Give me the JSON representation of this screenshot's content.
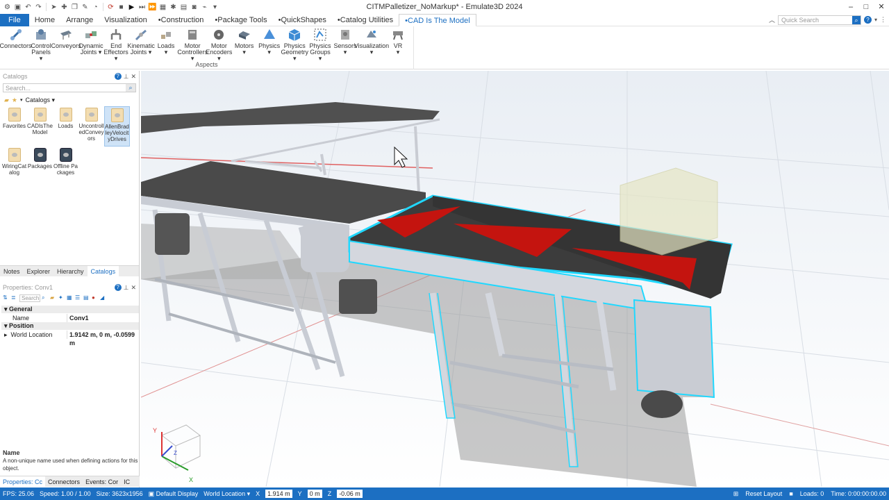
{
  "window": {
    "title": "CITMPalletizer_NoMarkup* - Emulate3D 2024",
    "controls": [
      "–",
      "□",
      "✕"
    ]
  },
  "tabs": [
    {
      "label": "File"
    },
    {
      "label": "Home"
    },
    {
      "label": "Arrange"
    },
    {
      "label": "Visualization"
    },
    {
      "label": "•Construction"
    },
    {
      "label": "•Package Tools"
    },
    {
      "label": "•QuickShapes"
    },
    {
      "label": "•Catalog Utilities"
    },
    {
      "label": "•CAD Is The Model"
    }
  ],
  "quick_search": {
    "placeholder": "Quick Search"
  },
  "ribbon": {
    "group_label": "Aspects",
    "buttons": [
      {
        "label": "Connectors"
      },
      {
        "label": "Control\nPanels ▾"
      },
      {
        "label": "Conveyors"
      },
      {
        "label": "Dynamic\nJoints ▾"
      },
      {
        "label": "End\nEffectors ▾"
      },
      {
        "label": "Kinematic\nJoints ▾"
      },
      {
        "label": "Loads\n▾"
      },
      {
        "label": "Motor\nControllers ▾"
      },
      {
        "label": "Motor\nEncoders ▾"
      },
      {
        "label": "Motors\n▾"
      },
      {
        "label": "Physics\n▾"
      },
      {
        "label": "Physics\nGeometry ▾"
      },
      {
        "label": "Physics\nGroups ▾"
      },
      {
        "label": "Sensors\n▾"
      },
      {
        "label": "Visualization\n▾"
      },
      {
        "label": "VR\n▾"
      }
    ]
  },
  "catalogs": {
    "title": "Catalogs",
    "search_placeholder": "Search...",
    "breadcrumb": "Catalogs ▾",
    "items": [
      {
        "label": "Favorites"
      },
      {
        "label": "CADIsTheModel"
      },
      {
        "label": "Loads"
      },
      {
        "label": "UncontrolledConveyors"
      },
      {
        "label": "AllenBradleyVelocityDrives"
      },
      {
        "label": "WiringCatalog"
      },
      {
        "label": "Packages"
      },
      {
        "label": "Offline Packages"
      }
    ]
  },
  "panel_tabs": [
    {
      "label": "Notes"
    },
    {
      "label": "Explorer"
    },
    {
      "label": "Hierarchy"
    },
    {
      "label": "Catalogs"
    }
  ],
  "properties": {
    "title": "Properties: Conv1",
    "search_placeholder": "Search",
    "sections": [
      {
        "name": "General"
      },
      {
        "name": "Position"
      }
    ],
    "rows": [
      {
        "key": "Name",
        "value": "Conv1"
      },
      {
        "key": "World Location",
        "value": "1.9142 m, 0 m, -0.0599 m"
      }
    ],
    "description_title": "Name",
    "description_text": "A non-unique name used when defining actions for this object."
  },
  "bottom_tabs": [
    {
      "label": "Properties: Cc"
    },
    {
      "label": "Connectors"
    },
    {
      "label": "Events: Cor"
    },
    {
      "label": "IC"
    }
  ],
  "axis_gizmo": {
    "x": "X",
    "y": "Y",
    "z": "Z"
  },
  "status": {
    "fps": "FPS: 25.06",
    "speed": "Speed: 1.00 / 1.00",
    "size": "Size: 3623x1956",
    "display": "Default Display",
    "location_mode": "World Location",
    "x_label": "X",
    "x_value": "1.914 m",
    "y_label": "Y",
    "y_value": "0 m",
    "z_label": "Z",
    "z_value": "-0.06 m",
    "reset_layout": "Reset Layout",
    "loads": "Loads: 0",
    "time": "Time: 0:00:00:00.00"
  },
  "colors": {
    "accent": "#1c6fc2",
    "selection_outline": "#20d8ff",
    "belt_arrow": "#c4140f"
  }
}
